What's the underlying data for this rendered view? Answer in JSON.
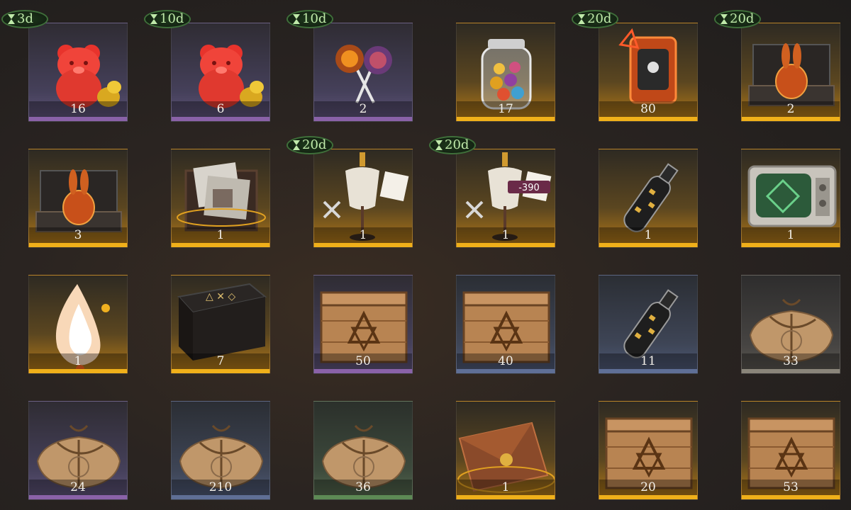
{
  "items": [
    {
      "name": "gummy-bear-item",
      "count": "16",
      "rarity": "purple",
      "icon": "gummy-bear-icon",
      "timer": "3d"
    },
    {
      "name": "gummy-bear-item",
      "count": "6",
      "rarity": "purple",
      "icon": "gummy-bear-icon",
      "timer": "10d"
    },
    {
      "name": "lollipop-item",
      "count": "2",
      "rarity": "purple",
      "icon": "lollipop-icon",
      "timer": "10d"
    },
    {
      "name": "candy-jar-item",
      "count": "17",
      "rarity": "gold",
      "icon": "candy-jar-icon",
      "timer": ""
    },
    {
      "name": "orange-device-item",
      "count": "80",
      "rarity": "gold",
      "icon": "device-icon",
      "timer": "20d"
    },
    {
      "name": "rabbit-box-item",
      "count": "2",
      "rarity": "gold",
      "icon": "rabbit-box-icon",
      "timer": "20d"
    },
    {
      "name": "golden-rabbit-box-item",
      "count": "3",
      "rarity": "gold",
      "icon": "rabbit-box-icon",
      "timer": ""
    },
    {
      "name": "photo-box-item",
      "count": "1",
      "rarity": "gold",
      "icon": "photo-box-icon",
      "timer": ""
    },
    {
      "name": "mannequin-item",
      "count": "1",
      "rarity": "gold",
      "icon": "mannequin-icon",
      "timer": "20d"
    },
    {
      "name": "mannequin-discount-item",
      "count": "1",
      "rarity": "gold",
      "icon": "mannequin-icon",
      "timer": "20d",
      "tag": "-390"
    },
    {
      "name": "bottle-item",
      "count": "1",
      "rarity": "gold",
      "icon": "bottle-icon",
      "timer": ""
    },
    {
      "name": "tv-item",
      "count": "1",
      "rarity": "gold",
      "icon": "tv-icon",
      "timer": ""
    },
    {
      "name": "flame-orb-item",
      "count": "1",
      "rarity": "gold",
      "icon": "flame-icon",
      "timer": ""
    },
    {
      "name": "rune-table-item",
      "count": "7",
      "rarity": "gold",
      "icon": "rune-table-icon",
      "timer": ""
    },
    {
      "name": "wooden-crate-item",
      "count": "50",
      "rarity": "purple",
      "icon": "crate-icon",
      "timer": ""
    },
    {
      "name": "wooden-crate-item",
      "count": "40",
      "rarity": "blue",
      "icon": "crate-icon",
      "timer": ""
    },
    {
      "name": "bottle-item",
      "count": "11",
      "rarity": "blue",
      "icon": "bottle-icon",
      "timer": ""
    },
    {
      "name": "parcel-item",
      "count": "33",
      "rarity": "gray",
      "icon": "parcel-icon",
      "timer": ""
    },
    {
      "name": "parcel-item",
      "count": "24",
      "rarity": "purple",
      "icon": "parcel-icon",
      "timer": ""
    },
    {
      "name": "parcel-item",
      "count": "210",
      "rarity": "blue",
      "icon": "parcel-icon",
      "timer": ""
    },
    {
      "name": "parcel-item",
      "count": "36",
      "rarity": "green",
      "icon": "parcel-icon",
      "timer": ""
    },
    {
      "name": "envelope-item",
      "count": "1",
      "rarity": "gold",
      "icon": "envelope-icon",
      "timer": ""
    },
    {
      "name": "wooden-crate-item",
      "count": "20",
      "rarity": "gold",
      "icon": "crate-icon",
      "timer": ""
    },
    {
      "name": "wooden-crate-item",
      "count": "53",
      "rarity": "gold",
      "icon": "crate-icon",
      "timer": ""
    }
  ],
  "colors": {
    "purple": "#8a62a8",
    "blue": "#5f6f96",
    "green": "#5d8a55",
    "gold": "#f0b01a",
    "gray": "#8a857a",
    "timer_text": "#bfe9a9"
  }
}
